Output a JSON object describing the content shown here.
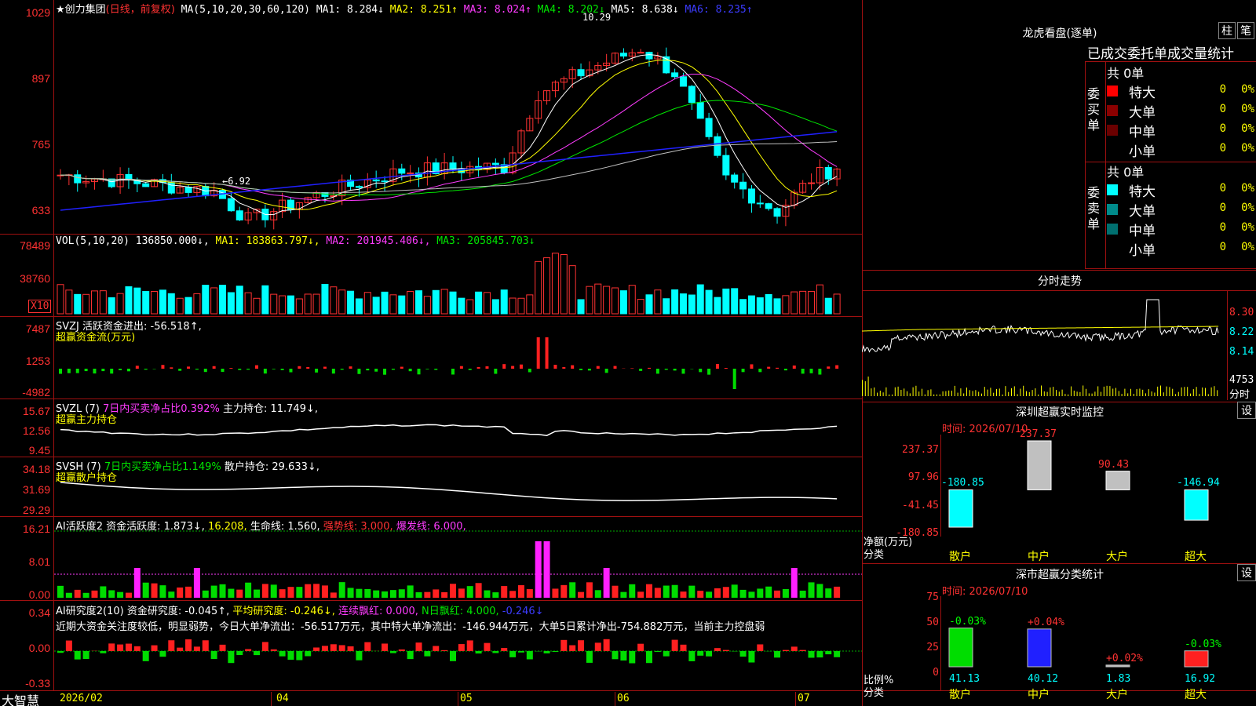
{
  "header": {
    "stock": "★创力集团",
    "mode": "(日线，前复权)",
    "ma_label": "MA(5,10,20,30,60,120)",
    "ma1": "MA1: 8.284↓",
    "ma2": "MA2: 8.251↑",
    "ma3": "MA3: 8.024↑",
    "ma4": "MA4: 8.202↓",
    "ma5": "MA5: 8.638↓",
    "ma6": "MA6: 8.235↑",
    "high_mark": "10.29",
    "low_mark": "←6.92"
  },
  "price_axis": [
    "1029",
    "897",
    "765",
    "633"
  ],
  "vol": {
    "legend": "VOL(5,10,20)",
    "val": "136850.000↓,",
    "ma1": "MA1: 183863.797↓,",
    "ma2": "MA2: 201945.406↓,",
    "ma3": "MA3: 205845.703↓",
    "axis": [
      "78489",
      "38760"
    ],
    "unit": "X10"
  },
  "svzj": {
    "legend": "SVZJ  活跃资金进出: -56.518↑,",
    "sub": "超赢资金流(万元)",
    "axis": [
      "7487",
      "1253",
      "-4982"
    ]
  },
  "svzl": {
    "legend1": "SVZL (7)",
    "legend2": "7日内买卖净占比0.392%",
    "legend3": "主力持仓: 11.749↓,",
    "sub": "超赢主力持仓",
    "axis": [
      "15.67",
      "12.56",
      "9.45"
    ]
  },
  "svsh": {
    "legend1": "SVSH (7)",
    "legend2": "7日内买卖净占比1.149%",
    "legend3": "散户持仓: 29.633↓,",
    "sub": "超赢散户持仓",
    "axis": [
      "34.18",
      "31.69",
      "29.29"
    ]
  },
  "ai1": {
    "legend1": "AI活跃度2",
    "legend2": "资金活跃度: 1.873↓,",
    "legend3": "16.208,",
    "legend4": "生命线: 1.560,",
    "legend5": "强势线: 3.000,",
    "legend6": "爆发线: 6.000,",
    "axis": [
      "16.21",
      "8.01",
      "0.00"
    ]
  },
  "ai2": {
    "legend1": "AI研究度2(10)",
    "legend2": "资金研究度: -0.045↑,",
    "legend3": "平均研究度: -0.246↓,",
    "legend4": "连续飘红: 0.000,",
    "legend5": "N日飘红: 4.000,",
    "legend6": "-0.246↓",
    "text": "近期大资金关注度较低，明显弱势，今日大单净流出：-56.517万元，其中特大单净流出：-146.944万元，大单5日累计净出-754.882万元，当前主力控盘弱",
    "axis": [
      "0.34",
      "0.00",
      "-0.33"
    ]
  },
  "bottom": {
    "brand": "大智慧",
    "dates": [
      "2026/02",
      "04",
      "05",
      "06",
      "07"
    ]
  },
  "lhb": {
    "title": "龙虎看盘(逐单)",
    "btn1": "柱",
    "btn2": "笔",
    "header": "已成交委托单成交量统计",
    "buy": {
      "label": "委买单",
      "total": "共 0单",
      "rows": [
        {
          "name": "特大",
          "v": "0",
          "p": "0%",
          "color": "#ff0000"
        },
        {
          "name": "大单",
          "v": "0",
          "p": "0%",
          "color": "#8b0000"
        },
        {
          "name": "中单",
          "v": "0",
          "p": "0%",
          "color": "#6b0000"
        },
        {
          "name": "小单",
          "v": "0",
          "p": "0%",
          "color": ""
        }
      ]
    },
    "sell": {
      "label": "委卖单",
      "total": "共 0单",
      "rows": [
        {
          "name": "特大",
          "v": "0",
          "p": "0%",
          "color": "#00ffff"
        },
        {
          "name": "大单",
          "v": "0",
          "p": "0%",
          "color": "#008b8b"
        },
        {
          "name": "中单",
          "v": "0",
          "p": "0%",
          "color": "#007070"
        },
        {
          "name": "小单",
          "v": "0",
          "p": "0%",
          "color": ""
        }
      ]
    }
  },
  "fenshi": {
    "title": "分时走势",
    "axis": [
      "8.30",
      "8.22",
      "8.14"
    ],
    "vol": "4753",
    "vol_label": "分时"
  },
  "sz_monitor": {
    "title": "深圳超赢实时监控",
    "btn": "设",
    "time": "时间: 2026/07/10",
    "axis": [
      "237.37",
      "97.96",
      "-41.45",
      "-180.85"
    ],
    "ylabel": "净额(万元)",
    "xlabel": "分类",
    "cats": [
      "散户",
      "中户",
      "大户",
      "超大"
    ],
    "values": [
      "-180.85",
      "237.37",
      "90.43",
      "-146.94"
    ]
  },
  "sz_stats": {
    "title": "深市超赢分类统计",
    "btn": "设",
    "time": "时间: 2026/07/10",
    "axis": [
      "75",
      "50",
      "25",
      "0"
    ],
    "ylabel": "比例%",
    "xlabel": "分类",
    "cats": [
      "散户",
      "中户",
      "大户",
      "超大"
    ],
    "values": [
      "41.13",
      "40.12",
      "1.83",
      "16.92"
    ],
    "changes": [
      "-0.03%",
      "+0.04%",
      "+0.02%",
      "-0.03%"
    ]
  },
  "chart_data": {
    "type": "candlestick",
    "title": "创力集团 日线",
    "price_range": [
      633,
      1029
    ],
    "date_ticks": [
      "2026/02",
      "04",
      "05",
      "06",
      "07"
    ],
    "price_annotations": {
      "high": 10.29,
      "low": 6.92
    },
    "ma_values": {
      "MA1": 8.284,
      "MA2": 8.251,
      "MA3": 8.024,
      "MA4": 8.202,
      "MA5": 8.638,
      "MA6": 8.235
    },
    "volume": {
      "current": 136850.0,
      "ma1": 183863.797,
      "ma2": 201945.406,
      "ma3": 205845.703
    },
    "sz_monitor_net": {
      "categories": [
        "散户",
        "中户",
        "大户",
        "超大"
      ],
      "values": [
        -180.85,
        237.37,
        90.43,
        -146.94
      ]
    },
    "sz_stats_ratio": {
      "categories": [
        "散户",
        "中户",
        "大户",
        "超大"
      ],
      "values": [
        41.13,
        40.12,
        1.83,
        16.92
      ]
    }
  }
}
